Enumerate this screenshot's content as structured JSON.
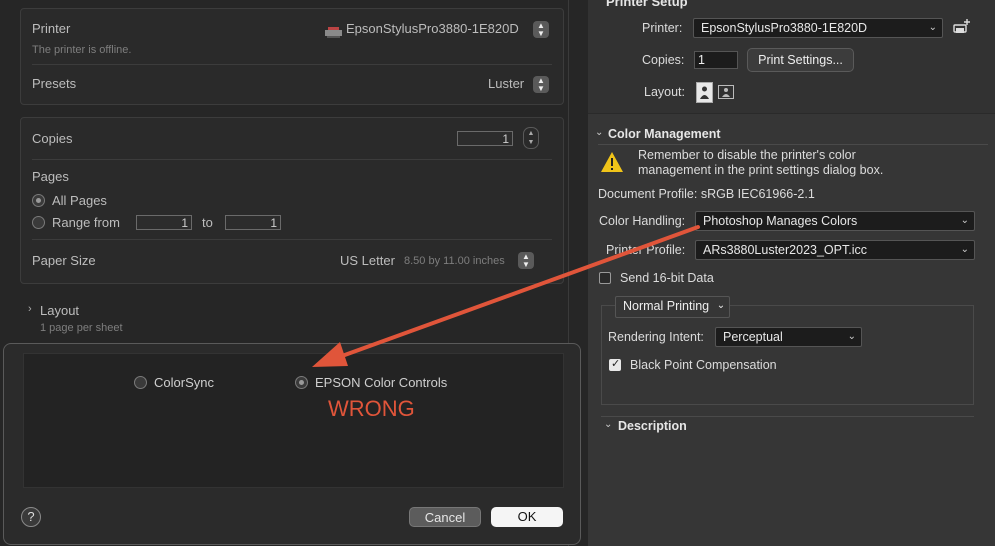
{
  "print_dialog": {
    "printer_label": "Printer",
    "printer_name": "EpsonStylusPro3880-1E820D",
    "printer_status": "The printer is offline.",
    "presets_label": "Presets",
    "presets_value": "Luster",
    "copies_label": "Copies",
    "copies_value": "1",
    "pages_label": "Pages",
    "all_pages": "All Pages",
    "range_from": "Range from",
    "range_from_value": "1",
    "range_to": "to",
    "range_to_value": "1",
    "paper_size_label": "Paper Size",
    "paper_size_value": "US Letter",
    "paper_size_dims": "8.50 by 11.00 inches",
    "layout_label": "Layout",
    "layout_sub": "1 page per sheet"
  },
  "sheet": {
    "option_colorsync": "ColorSync",
    "option_epson": "EPSON Color Controls",
    "selected": "EPSON Color Controls",
    "annotation": "WRONG",
    "help": "?",
    "cancel": "Cancel",
    "ok": "OK"
  },
  "photoshop": {
    "section_title": "Printer Setup",
    "printer_label": "Printer:",
    "printer_value": "EpsonStylusPro3880-1E820D",
    "copies_label": "Copies:",
    "copies_value": "1",
    "print_settings": "Print Settings...",
    "layout_label": "Layout:",
    "color_management": {
      "title": "Color Management",
      "warning": "Remember to disable the printer's color management in the print settings dialog box.",
      "document_profile": "Document Profile: sRGB IEC61966-2.1",
      "color_handling_label": "Color Handling:",
      "color_handling_value": "Photoshop Manages Colors",
      "printer_profile_label": "Printer Profile:",
      "printer_profile_value": "ARs3880Luster2023_OPT.icc",
      "send_16bit": "Send 16-bit Data",
      "send_16bit_checked": false,
      "printing_mode": "Normal Printing",
      "rendering_intent_label": "Rendering Intent:",
      "rendering_intent_value": "Perceptual",
      "black_point": "Black Point Compensation",
      "black_point_checked": true
    },
    "description_title": "Description"
  },
  "colors": {
    "arrow": "#e0553a",
    "warning": "#f0c419"
  }
}
